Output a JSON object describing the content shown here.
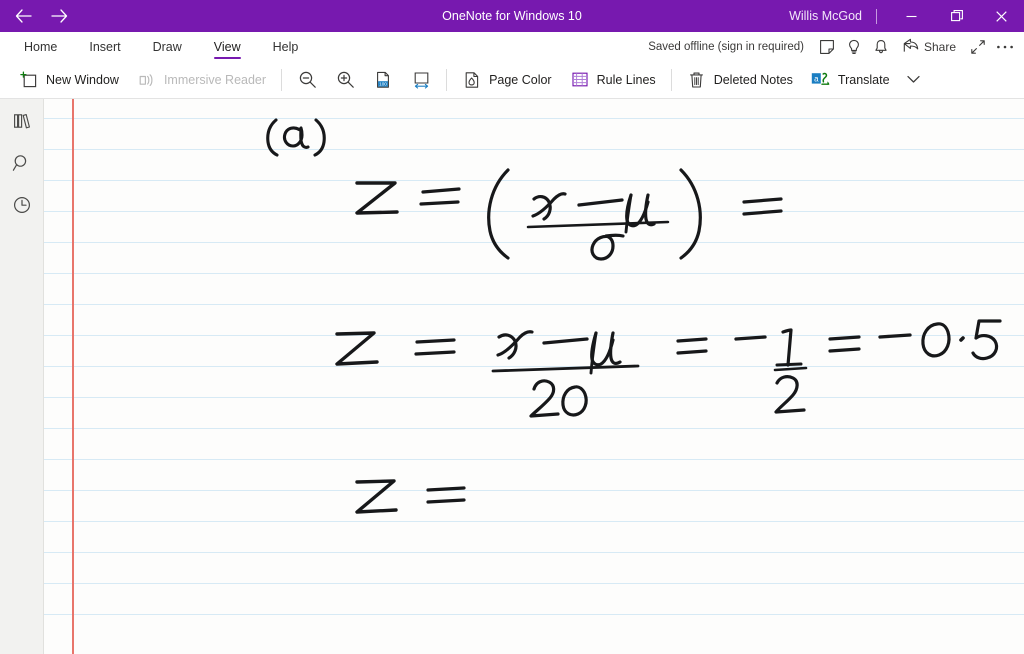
{
  "titlebar": {
    "app_title": "OneNote for Windows 10",
    "account_name": "Willis McGod",
    "back_icon": "back-arrow-icon",
    "forward_icon": "forward-arrow-icon",
    "minimize_label": "Minimize",
    "restore_label": "Restore",
    "close_label": "Close",
    "accent_color": "#7719AF"
  },
  "tabs": {
    "items": [
      {
        "label": "Home",
        "active": false
      },
      {
        "label": "Insert",
        "active": false
      },
      {
        "label": "Draw",
        "active": false
      },
      {
        "label": "View",
        "active": true
      },
      {
        "label": "Help",
        "active": false
      }
    ],
    "status_text": "Saved offline (sign in required)",
    "sticky_notes_icon": "sticky-note-icon",
    "tell_me_icon": "lightbulb-icon",
    "notifications_icon": "bell-icon",
    "share_label": "Share",
    "share_icon": "share-icon",
    "expand_icon": "expand-diagonal-icon",
    "more_icon": "ellipsis-icon"
  },
  "ribbon": {
    "items": [
      {
        "label": "New Window",
        "icon": "new-window-icon",
        "disabled": false
      },
      {
        "label": "Immersive Reader",
        "icon": "immersive-reader-icon",
        "disabled": true
      },
      {
        "label": "",
        "icon": "zoom-out-icon",
        "disabled": false
      },
      {
        "label": "",
        "icon": "zoom-in-icon",
        "disabled": false
      },
      {
        "label": "",
        "icon": "zoom-100-icon",
        "disabled": false
      },
      {
        "label": "",
        "icon": "page-width-icon",
        "disabled": false
      },
      {
        "label": "Page Color",
        "icon": "page-color-icon",
        "disabled": false
      },
      {
        "label": "Rule Lines",
        "icon": "rule-lines-icon",
        "disabled": false
      },
      {
        "label": "Deleted Notes",
        "icon": "trash-icon",
        "disabled": false
      },
      {
        "label": "Translate",
        "icon": "translate-icon",
        "disabled": false
      }
    ],
    "overflow_icon": "chevron-down-icon"
  },
  "rail": {
    "items": [
      {
        "name": "notebooks",
        "icon": "notebooks-icon"
      },
      {
        "name": "search",
        "icon": "search-icon"
      },
      {
        "name": "recent-notes",
        "icon": "clock-icon"
      }
    ]
  },
  "page": {
    "rule_color": "#d7eaf5",
    "margin_color": "#e8756b",
    "background": "#fdfdfc",
    "ink_color": "#17181a",
    "handwriting": [
      {
        "id": "label-a",
        "text": "(a)"
      },
      {
        "id": "equation-1",
        "text": "Z = ( (x - μ) / σ ) ="
      },
      {
        "id": "equation-2",
        "text": "Z = (x - μ) / 20 = - 1/2 = - 0.5"
      },
      {
        "id": "equation-3",
        "text": "Z ="
      }
    ]
  }
}
